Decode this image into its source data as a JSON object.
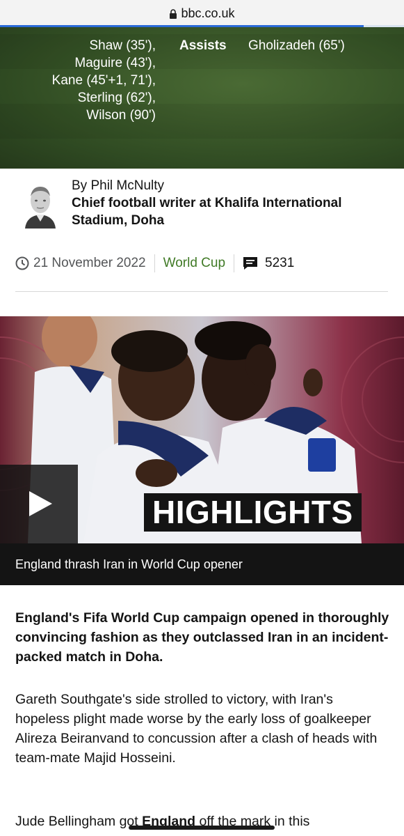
{
  "browser": {
    "url": "bbc.co.uk",
    "icon": "lock-icon",
    "load_progress": 0.9
  },
  "match": {
    "england_scorers": [
      "Shaw (35'),",
      "Maguire (43'),",
      "Kane (45'+1, 71'),",
      "Sterling (62'),",
      "Wilson (90')"
    ],
    "assists_label": "Assists",
    "iran_scorers": [
      "Gholizadeh (65')"
    ]
  },
  "byline": {
    "author": "By Phil McNulty",
    "role": "Chief football writer at Khalifa International Stadium, Doha"
  },
  "meta": {
    "date": "21 November 2022",
    "topic": "World Cup",
    "comments": "5231",
    "clock_icon": "clock-icon",
    "comments_icon": "comments-icon"
  },
  "media": {
    "badge": "HIGHLIGHTS",
    "caption": "England thrash Iran in World Cup opener",
    "play_icon": "play-icon"
  },
  "article": {
    "lead": "England's Fifa World Cup campaign opened in thoroughly convincing fashion as they outclassed Iran in an incident-packed match in Doha.",
    "para1": "Gareth Southgate's side strolled to victory, with Iran's hopeless plight made worse by the early loss of goalkeeper Alireza Beiranvand to concussion after a clash of heads with team-mate Majid Hosseini.",
    "para2_start": "Jude Bellingham got ",
    "para2_link": "England",
    "para2_end": " off the mark in this"
  },
  "colors": {
    "accent_green": "#407a26",
    "media_maroon": "#5b1a2c",
    "dark": "#141414"
  }
}
